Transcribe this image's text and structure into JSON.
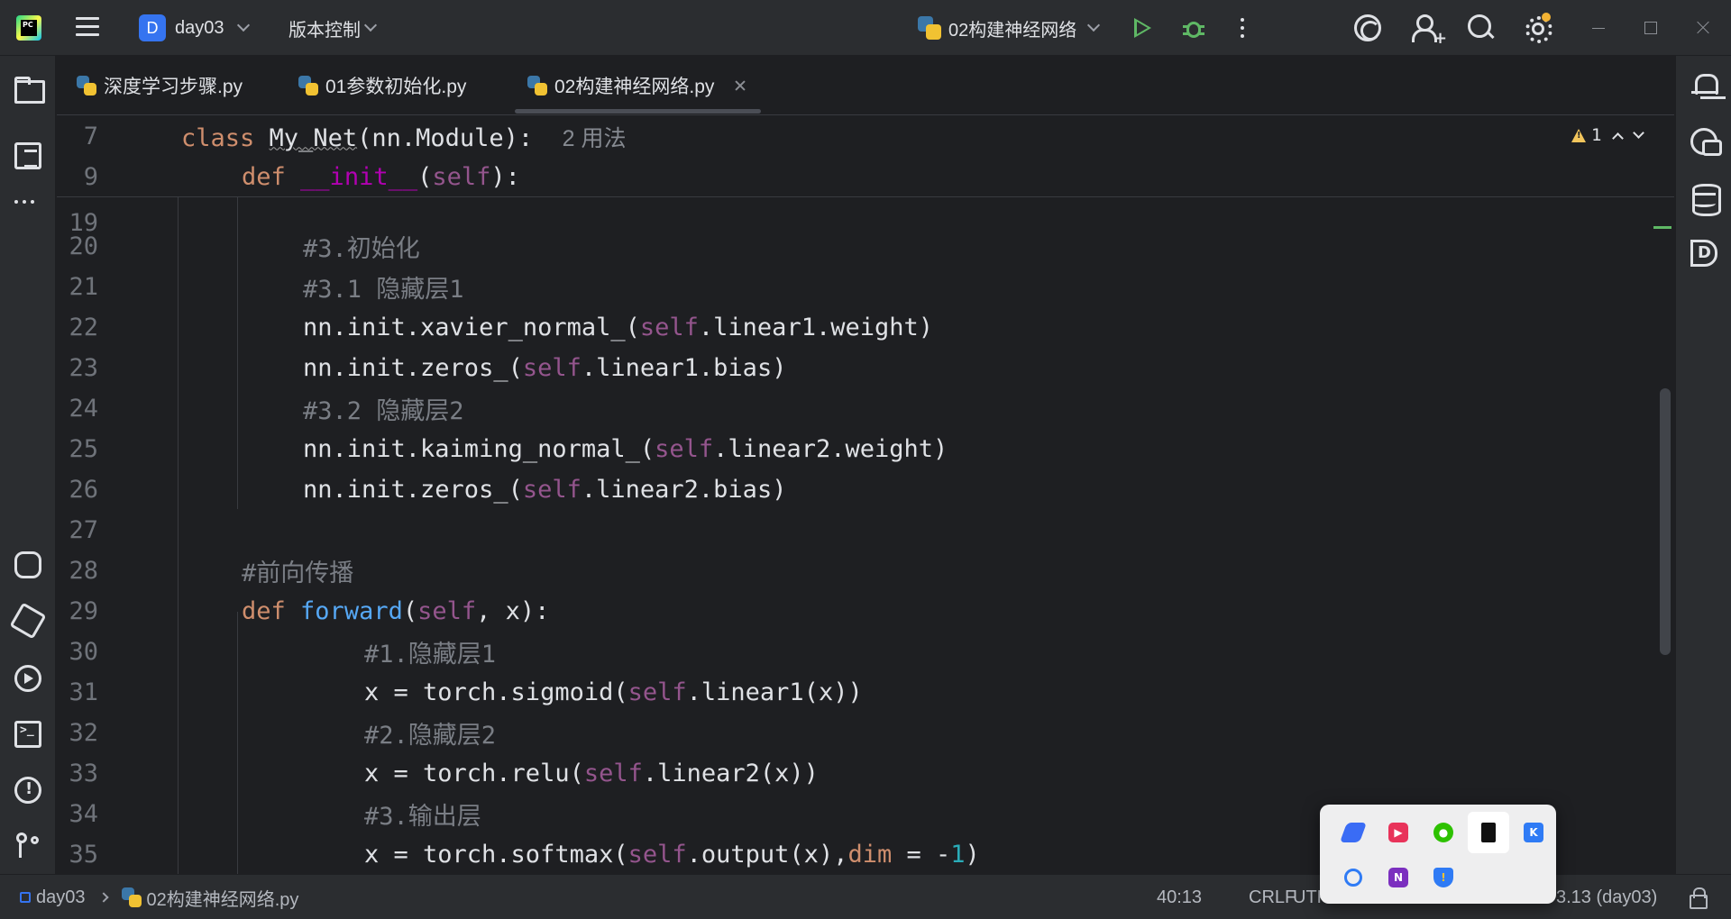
{
  "titlebar": {
    "project_badge": "D",
    "project_name": "day03",
    "vcs_label": "版本控制",
    "run_config": "02构建神经网络"
  },
  "tabs": [
    {
      "label": "深度学习步骤.py"
    },
    {
      "label": "01参数初始化.py"
    },
    {
      "label": "02构建神经网络.py",
      "active": true
    }
  ],
  "editor": {
    "sticky": [
      {
        "num": "7",
        "usage": "2 用法"
      },
      {
        "num": "9"
      }
    ],
    "lines": [
      {
        "num": "19"
      },
      {
        "num": "20",
        "comment": "#3.初始化"
      },
      {
        "num": "21",
        "comment": "#3.1 隐藏层1"
      },
      {
        "num": "22"
      },
      {
        "num": "23"
      },
      {
        "num": "24",
        "comment": "#3.2 隐藏层2"
      },
      {
        "num": "25"
      },
      {
        "num": "26"
      },
      {
        "num": "27"
      },
      {
        "num": "28",
        "comment": "#前向传播"
      },
      {
        "num": "29"
      },
      {
        "num": "30",
        "comment": "#1.隐藏层1"
      },
      {
        "num": "31"
      },
      {
        "num": "32",
        "comment": "#2.隐藏层2"
      },
      {
        "num": "33"
      },
      {
        "num": "34",
        "comment": "#3.输出层"
      },
      {
        "num": "35"
      }
    ],
    "inspection_count": "1"
  },
  "statusbar": {
    "project": "day03",
    "file": "02构建神经网络.py",
    "position": "40:13",
    "line_ending": "CRLF",
    "encoding": "UTF",
    "interpreter": "3.13 (day03)"
  },
  "tray": {
    "apps": [
      "feishu-icon",
      "bilibili-icon",
      "wechat-icon",
      "bookmark-app-icon",
      "k-app-icon",
      "sync-icon",
      "onenote-icon",
      "security-center-icon"
    ]
  },
  "colors": {
    "background": "#1e1f22",
    "panel": "#2b2d30",
    "keyword": "#cf8e6d",
    "self": "#94558d",
    "function": "#56a8f5",
    "dunder": "#b200b2",
    "comment": "#7a7e85",
    "number": "#2aacb8",
    "run_green": "#5fb865",
    "accent_blue": "#3574f0"
  }
}
